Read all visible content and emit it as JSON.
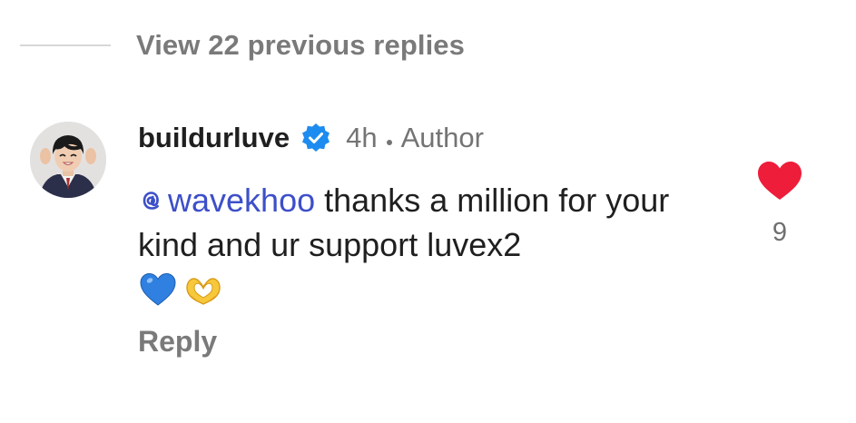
{
  "thread": {
    "view_replies_label": "View 22 previous replies"
  },
  "comment": {
    "username": "buildurluve",
    "verified": true,
    "time": "4h",
    "author_badge": "Author",
    "mention": "wavekhoo",
    "text": "thanks a million for your kind and ur support luvex2",
    "emojis": [
      "blue-heart",
      "heart-hands"
    ],
    "reply_label": "Reply",
    "likes": "9",
    "liked": true
  },
  "colors": {
    "like_heart": "#ee1d3a",
    "verified_badge": "#1d8cf0",
    "mention": "#3d4fc9",
    "muted_text": "#7a7a7a"
  },
  "icons": {
    "verified": "verified-badge-icon",
    "mention": "threads-at-icon",
    "like": "heart-icon"
  }
}
